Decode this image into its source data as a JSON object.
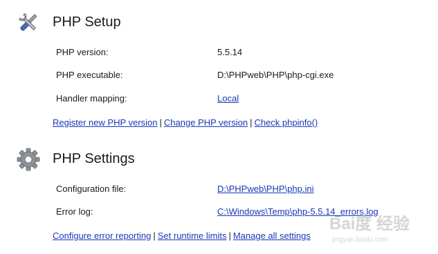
{
  "setup": {
    "title": "PHP Setup",
    "icon": "wrench-screwdriver-icon",
    "rows": [
      {
        "label": "PHP version:",
        "value": "5.5.14"
      },
      {
        "label": "PHP executable:",
        "value": "D:\\PHPweb\\PHP\\php-cgi.exe"
      },
      {
        "label": "Handler mapping:",
        "value": "Local"
      }
    ],
    "links": [
      "Register new PHP version",
      "Change PHP version",
      "Check phpinfo()"
    ]
  },
  "settings": {
    "title": "PHP Settings",
    "icon": "gear-icon",
    "rows": [
      {
        "label": "Configuration file:",
        "value": "D:\\PHPweb\\PHP\\php.ini"
      },
      {
        "label": "Error log:",
        "value": "C:\\Windows\\Temp\\php-5.5.14_errors.log"
      }
    ],
    "links": [
      "Configure error reporting",
      "Set runtime limits",
      "Manage all settings"
    ]
  },
  "separator": "|",
  "watermark": {
    "brand": "Bai度 经验",
    "url": "jingyan.baidu.com"
  }
}
